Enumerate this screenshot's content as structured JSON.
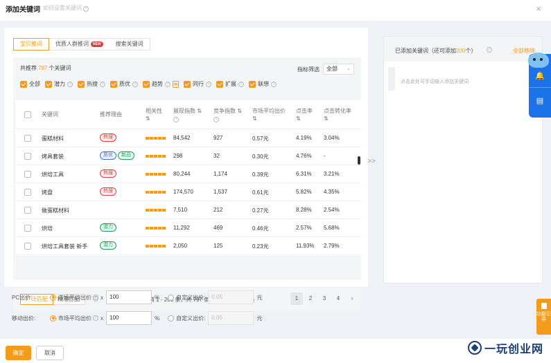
{
  "dialog": {
    "title": "添加关键词",
    "help_link": "如何设置关键词",
    "close_glyph": "×"
  },
  "tabs": [
    {
      "label": "宝贝推词",
      "active": true
    },
    {
      "label": "优质人群推词",
      "badge": "NEW",
      "active": false
    },
    {
      "label": "搜索关键词",
      "active": false
    }
  ],
  "recommend": {
    "prefix": "共推荐",
    "count": "797",
    "suffix": "个关键词",
    "filter_label": "指标筛选",
    "filter_value": "全部"
  },
  "filters": [
    {
      "label": "全部",
      "checked": true
    },
    {
      "label": "潜力",
      "checked": true
    },
    {
      "label": "热搜",
      "checked": true
    },
    {
      "label": "质优",
      "checked": true
    },
    {
      "label": "趋势",
      "checked": true
    },
    {
      "label": "同行",
      "checked": true
    },
    {
      "label": "扩展",
      "checked": true
    },
    {
      "label": "联想",
      "checked": true
    }
  ],
  "table": {
    "headers": {
      "keyword": "关键词",
      "reason": "推荐理由",
      "relevance": "相关性",
      "impressions": "展现指数",
      "competition": "竞争指数",
      "avg_bid": "市场平均出价",
      "ctr": "点击率",
      "cvr": "点击转化率"
    },
    "sort_glyph": "⇅",
    "rows": [
      {
        "keyword": "蛋糕材料",
        "tags": [
          {
            "text": "热搜",
            "color": "red"
          }
        ],
        "relevance": 5,
        "impressions": "84,542",
        "competition": "927",
        "avg_bid": "0.57元",
        "ctr": "4.19%",
        "cvr": "3.04%"
      },
      {
        "keyword": "烤具套装",
        "tags": [
          {
            "text": "质优",
            "color": "blue"
          },
          {
            "text": "新品",
            "color": "green"
          }
        ],
        "relevance": 5,
        "impressions": "298",
        "competition": "32",
        "avg_bid": "0.30元",
        "ctr": "4.76%",
        "cvr": "-"
      },
      {
        "keyword": "烘培工具",
        "tags": [
          {
            "text": "热搜",
            "color": "red"
          }
        ],
        "relevance": 5,
        "impressions": "80,244",
        "competition": "1,174",
        "avg_bid": "0.39元",
        "ctr": "6.31%",
        "cvr": "3.21%"
      },
      {
        "keyword": "烤盘",
        "tags": [
          {
            "text": "热搜",
            "color": "red"
          }
        ],
        "relevance": 5,
        "impressions": "174,570",
        "competition": "1,537",
        "avg_bid": "0.61元",
        "ctr": "5.82%",
        "cvr": "4.35%"
      },
      {
        "keyword": "做蛋糕材料",
        "tags": [],
        "relevance": 5,
        "impressions": "7,510",
        "competition": "212",
        "avg_bid": "0.27元",
        "ctr": "8.28%",
        "cvr": "2.54%"
      },
      {
        "keyword": "烘培",
        "tags": [
          {
            "text": "潜力",
            "color": "green"
          }
        ],
        "relevance": 5,
        "impressions": "11,292",
        "competition": "469",
        "avg_bid": "0.46元",
        "ctr": "2.57%",
        "cvr": "5.68%"
      },
      {
        "keyword": "烘培工具套装 新手",
        "tags": [
          {
            "text": "潜力",
            "color": "green"
          }
        ],
        "relevance": 5,
        "impressions": "2,050",
        "competition": "125",
        "avg_bid": "0.23元",
        "ctr": "11.93%",
        "cvr": "2.79%"
      }
    ]
  },
  "match": {
    "broad": "广泛匹配",
    "exact": "精准匹配"
  },
  "pagination": {
    "info": "当前第 1 - 200 条，共 797 条，每页展示 200 条",
    "pages": [
      "1",
      "2",
      "3",
      "4"
    ],
    "current": "1",
    "next_glyph": "›"
  },
  "transfer_glyph": ">>",
  "added": {
    "title_prefix": "已添加关键词（还可添加",
    "remaining": "200",
    "title_suffix": "个）",
    "clear_all": "全部移除",
    "input_placeholder": "点击此处可手动输入添加关键词"
  },
  "bids": {
    "pc_label": "PC出价:",
    "mobile_label": "移动出价:",
    "market_avg": "市场平均出价",
    "multiplier": "x",
    "pc_value": "100",
    "mobile_value": "100",
    "percent": "%",
    "custom": "自定义出价:",
    "custom_placeholder": "0.05",
    "unit": "元"
  },
  "side": {
    "guide_label": "功能引导"
  },
  "buttons": {
    "ok": "确定",
    "cancel": "取消"
  },
  "watermark": "一玩创业网",
  "colors": {
    "accent": "#f39b1a",
    "float_blue": "#1a73e8",
    "tag_red": "#e23b3b",
    "tag_blue": "#3a6fd8",
    "tag_green": "#18a058"
  }
}
